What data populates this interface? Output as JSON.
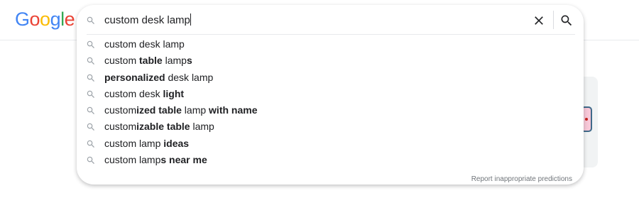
{
  "logo": {
    "letters": [
      {
        "char": "G",
        "color": "#4285F4"
      },
      {
        "char": "o",
        "color": "#EA4335"
      },
      {
        "char": "o",
        "color": "#FBBC05"
      },
      {
        "char": "g",
        "color": "#4285F4"
      },
      {
        "char": "l",
        "color": "#34A853"
      },
      {
        "char": "e",
        "color": "#EA4335"
      }
    ]
  },
  "search": {
    "query": "custom desk lamp",
    "clear_icon": "close-icon",
    "search_icon": "search-icon"
  },
  "suggestions": [
    {
      "parts": [
        {
          "t": "custom desk lamp",
          "b": false
        }
      ]
    },
    {
      "parts": [
        {
          "t": "custom ",
          "b": false
        },
        {
          "t": "table",
          "b": true
        },
        {
          "t": " lamp",
          "b": false
        },
        {
          "t": "s",
          "b": true
        }
      ]
    },
    {
      "parts": [
        {
          "t": "personalized",
          "b": true
        },
        {
          "t": " desk lamp",
          "b": false
        }
      ]
    },
    {
      "parts": [
        {
          "t": "custom desk ",
          "b": false
        },
        {
          "t": "light",
          "b": true
        }
      ]
    },
    {
      "parts": [
        {
          "t": "custom",
          "b": false
        },
        {
          "t": "ized table",
          "b": true
        },
        {
          "t": " lamp ",
          "b": false
        },
        {
          "t": "with name",
          "b": true
        }
      ]
    },
    {
      "parts": [
        {
          "t": "custom",
          "b": false
        },
        {
          "t": "izable table",
          "b": true
        },
        {
          "t": " lamp",
          "b": false
        }
      ]
    },
    {
      "parts": [
        {
          "t": "custom lamp ",
          "b": false
        },
        {
          "t": "ideas",
          "b": true
        }
      ]
    },
    {
      "parts": [
        {
          "t": "custom lamp",
          "b": false
        },
        {
          "t": "s near me",
          "b": true
        }
      ]
    }
  ],
  "report_link": "Report inappropriate predictions",
  "colors": {
    "text": "#202124",
    "icon": "#70757a",
    "divider": "#e8eaed"
  }
}
